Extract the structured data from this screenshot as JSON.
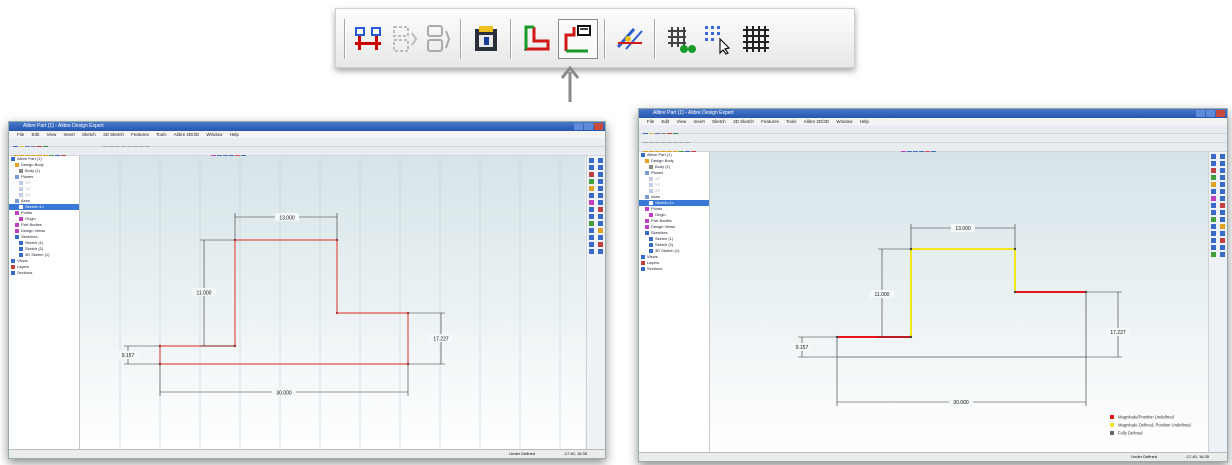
{
  "toolbar": {
    "buttons": [
      {
        "name": "symmetric-relation-icon",
        "state": "enabled"
      },
      {
        "name": "constraint-relation-icon",
        "state": "disabled"
      },
      {
        "name": "delete-relation-icon",
        "state": "disabled"
      },
      {
        "name": "clipboard-icon",
        "state": "enabled"
      },
      {
        "name": "fully-define-sketch-icon",
        "state": "enabled"
      },
      {
        "name": "display-sketch-status-icon",
        "state": "active"
      },
      {
        "name": "check-sketch-icon",
        "state": "enabled"
      },
      {
        "name": "grid-settings-icon",
        "state": "enabled"
      },
      {
        "name": "snap-to-grid-icon",
        "state": "enabled"
      },
      {
        "name": "grid-icon",
        "state": "enabled"
      }
    ]
  },
  "left_window": {
    "title": "Alibre Part (1) - Alibre Design Expert",
    "menu": [
      "File",
      "Edit",
      "View",
      "Insert",
      "Sketch",
      "3D Sketch",
      "Features",
      "Tools",
      "Alibre 2D/3D",
      "Window",
      "Help"
    ],
    "dimensions": {
      "top": "13.000",
      "left_riser": "11.000",
      "left": "9.157",
      "right": "17.227",
      "bottom": "30.000"
    },
    "status_left": "Under Defined",
    "status_right": "-17.40, 16.35",
    "line_color": "#e0524a"
  },
  "right_window": {
    "title": "Alibre Part (1) - Alibre Design Expert",
    "menu": [
      "File",
      "Edit",
      "View",
      "Insert",
      "Sketch",
      "3D Sketch",
      "Features",
      "Tools",
      "Alibre 2D/3D",
      "Window",
      "Help"
    ],
    "dimensions": {
      "top": "13.000",
      "left_riser": "11.000",
      "left": "9.157",
      "right": "17.227",
      "bottom": "30.000"
    },
    "legend": [
      {
        "label": "Magnitude/Position Undefined",
        "color": "#e8141c"
      },
      {
        "label": "Magnitude Defined, Position Undefined",
        "color": "#f0e61c"
      },
      {
        "label": "Fully Defined",
        "color": "#666666"
      }
    ],
    "status_left": "Under Defined",
    "status_right": "-17.40, 16.35"
  },
  "tree_items": [
    "Alibre Part (1)",
    "Design Body",
    "Body (1)",
    "Planes",
    "XY",
    "YZ",
    "ZX",
    "Axes",
    "Sketch<1>",
    "Points",
    "Origin",
    "Part Bodies",
    "Design Views",
    "Sketches",
    "Sketch (1)",
    "Sketch (2)",
    "3D Sketch (1)",
    "Views",
    "Layers",
    "Sections"
  ]
}
